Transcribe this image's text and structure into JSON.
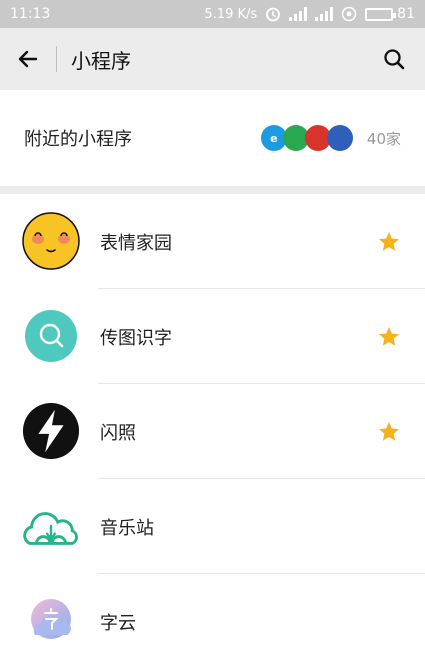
{
  "status_bar": {
    "time": "11:13",
    "speed": "5.19 K/s",
    "battery": "81",
    "battery_level": 0.81
  },
  "header": {
    "title": "小程序"
  },
  "nearby": {
    "label": "附近的小程序",
    "count": "40家"
  },
  "apps": [
    {
      "name": "表情家园",
      "starred": true
    },
    {
      "name": "传图识字",
      "starred": true
    },
    {
      "name": "闪照",
      "starred": true
    },
    {
      "name": "音乐站",
      "starred": false
    },
    {
      "name": "字云",
      "starred": false
    }
  ],
  "colors": {
    "star": "#f6b21b",
    "emoji_face": "#f7c325",
    "ocr_circle": "#4fc9c0",
    "flash_circle": "#111111",
    "music_green": "#26b58a"
  }
}
